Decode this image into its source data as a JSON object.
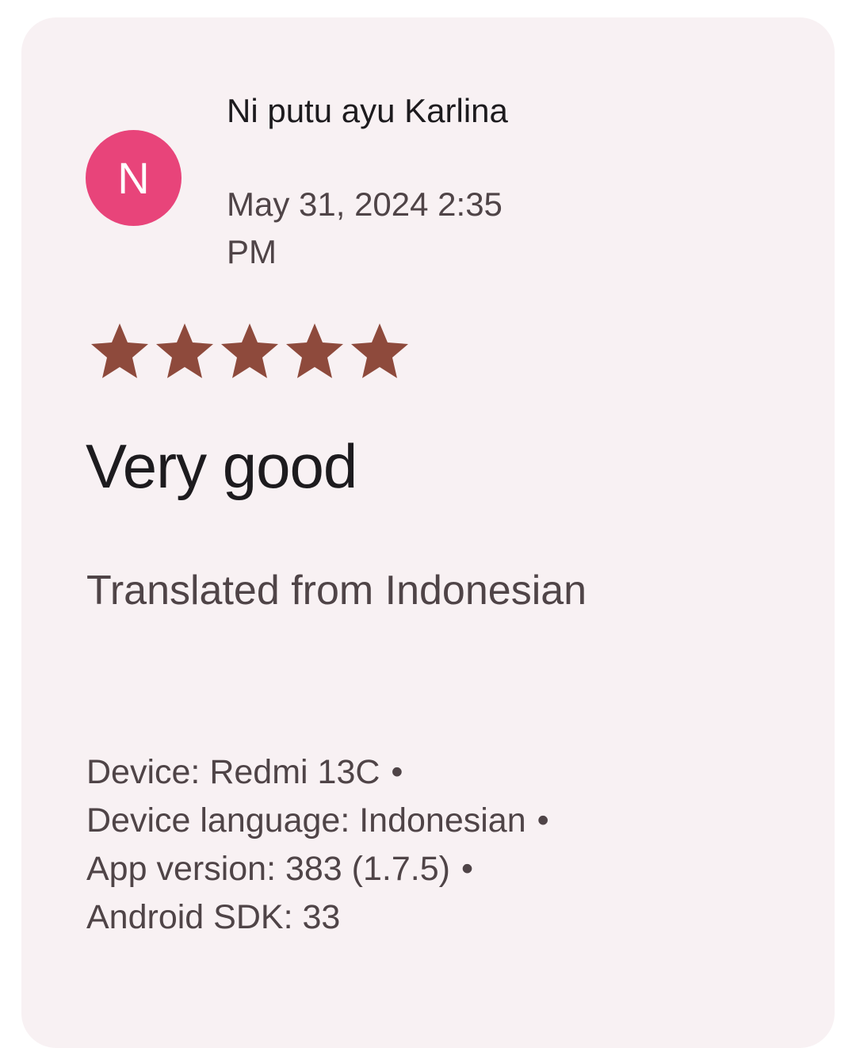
{
  "review": {
    "avatar_letter": "N",
    "avatar_color": "#E8447A",
    "author": "Ni putu ayu Karlina",
    "timestamp": "May 31, 2024 2:35 PM",
    "rating": 5,
    "rating_max": 5,
    "star_color": "#8E4A3C",
    "title": "Very good",
    "translation_note": "Translated from Indonesian"
  },
  "device_info": {
    "device": "Device: Redmi 13C",
    "language": "Device language: Indonesian",
    "app_version": "App version: 383 (1.7.5)",
    "sdk": "Android SDK: 33",
    "separator": "•"
  }
}
